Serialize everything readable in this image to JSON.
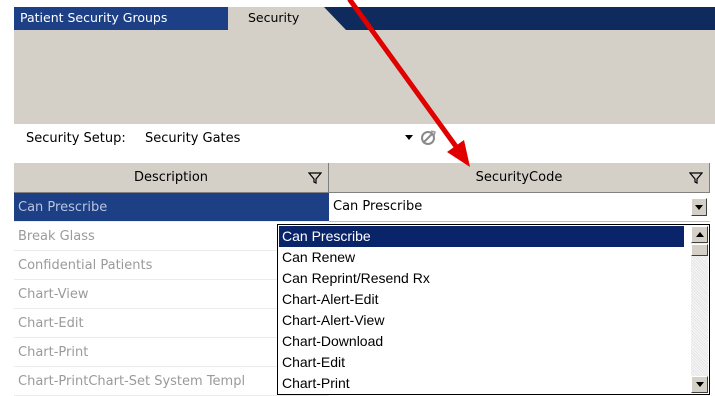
{
  "tabs": [
    {
      "label": "Patient Security Groups"
    },
    {
      "label": "Security"
    }
  ],
  "setup": {
    "label": "Security Setup:",
    "value": "Security Gates"
  },
  "grid": {
    "columns": [
      "Description",
      "SecurityCode"
    ],
    "rows": [
      {
        "description": "Can Prescribe",
        "selected": true
      },
      {
        "description": "Break Glass"
      },
      {
        "description": "Confidential Patients"
      },
      {
        "description": "Chart-View"
      },
      {
        "description": "Chart-Edit"
      },
      {
        "description": "Chart-Print"
      },
      {
        "description": "Chart-PrintChart-Set System Templ"
      }
    ],
    "editing_code_value": "Can Prescribe"
  },
  "dropdown": {
    "items": [
      {
        "label": "Can Prescribe",
        "selected": true
      },
      {
        "label": "Can Renew"
      },
      {
        "label": "Can Reprint/Resend Rx"
      },
      {
        "label": "Chart-Alert-Edit"
      },
      {
        "label": "Chart-Alert-View"
      },
      {
        "label": "Chart-Download"
      },
      {
        "label": "Chart-Edit"
      },
      {
        "label": "Chart-Print"
      }
    ]
  },
  "colors": {
    "tabbar": "#0f2a5c",
    "selection": "#1c3f86",
    "dropdown_selection": "#0a246a",
    "annotation_arrow": "#e00000"
  },
  "icons": [
    "filter-icon",
    "clear-icon",
    "dropdown-arrow-icon"
  ]
}
